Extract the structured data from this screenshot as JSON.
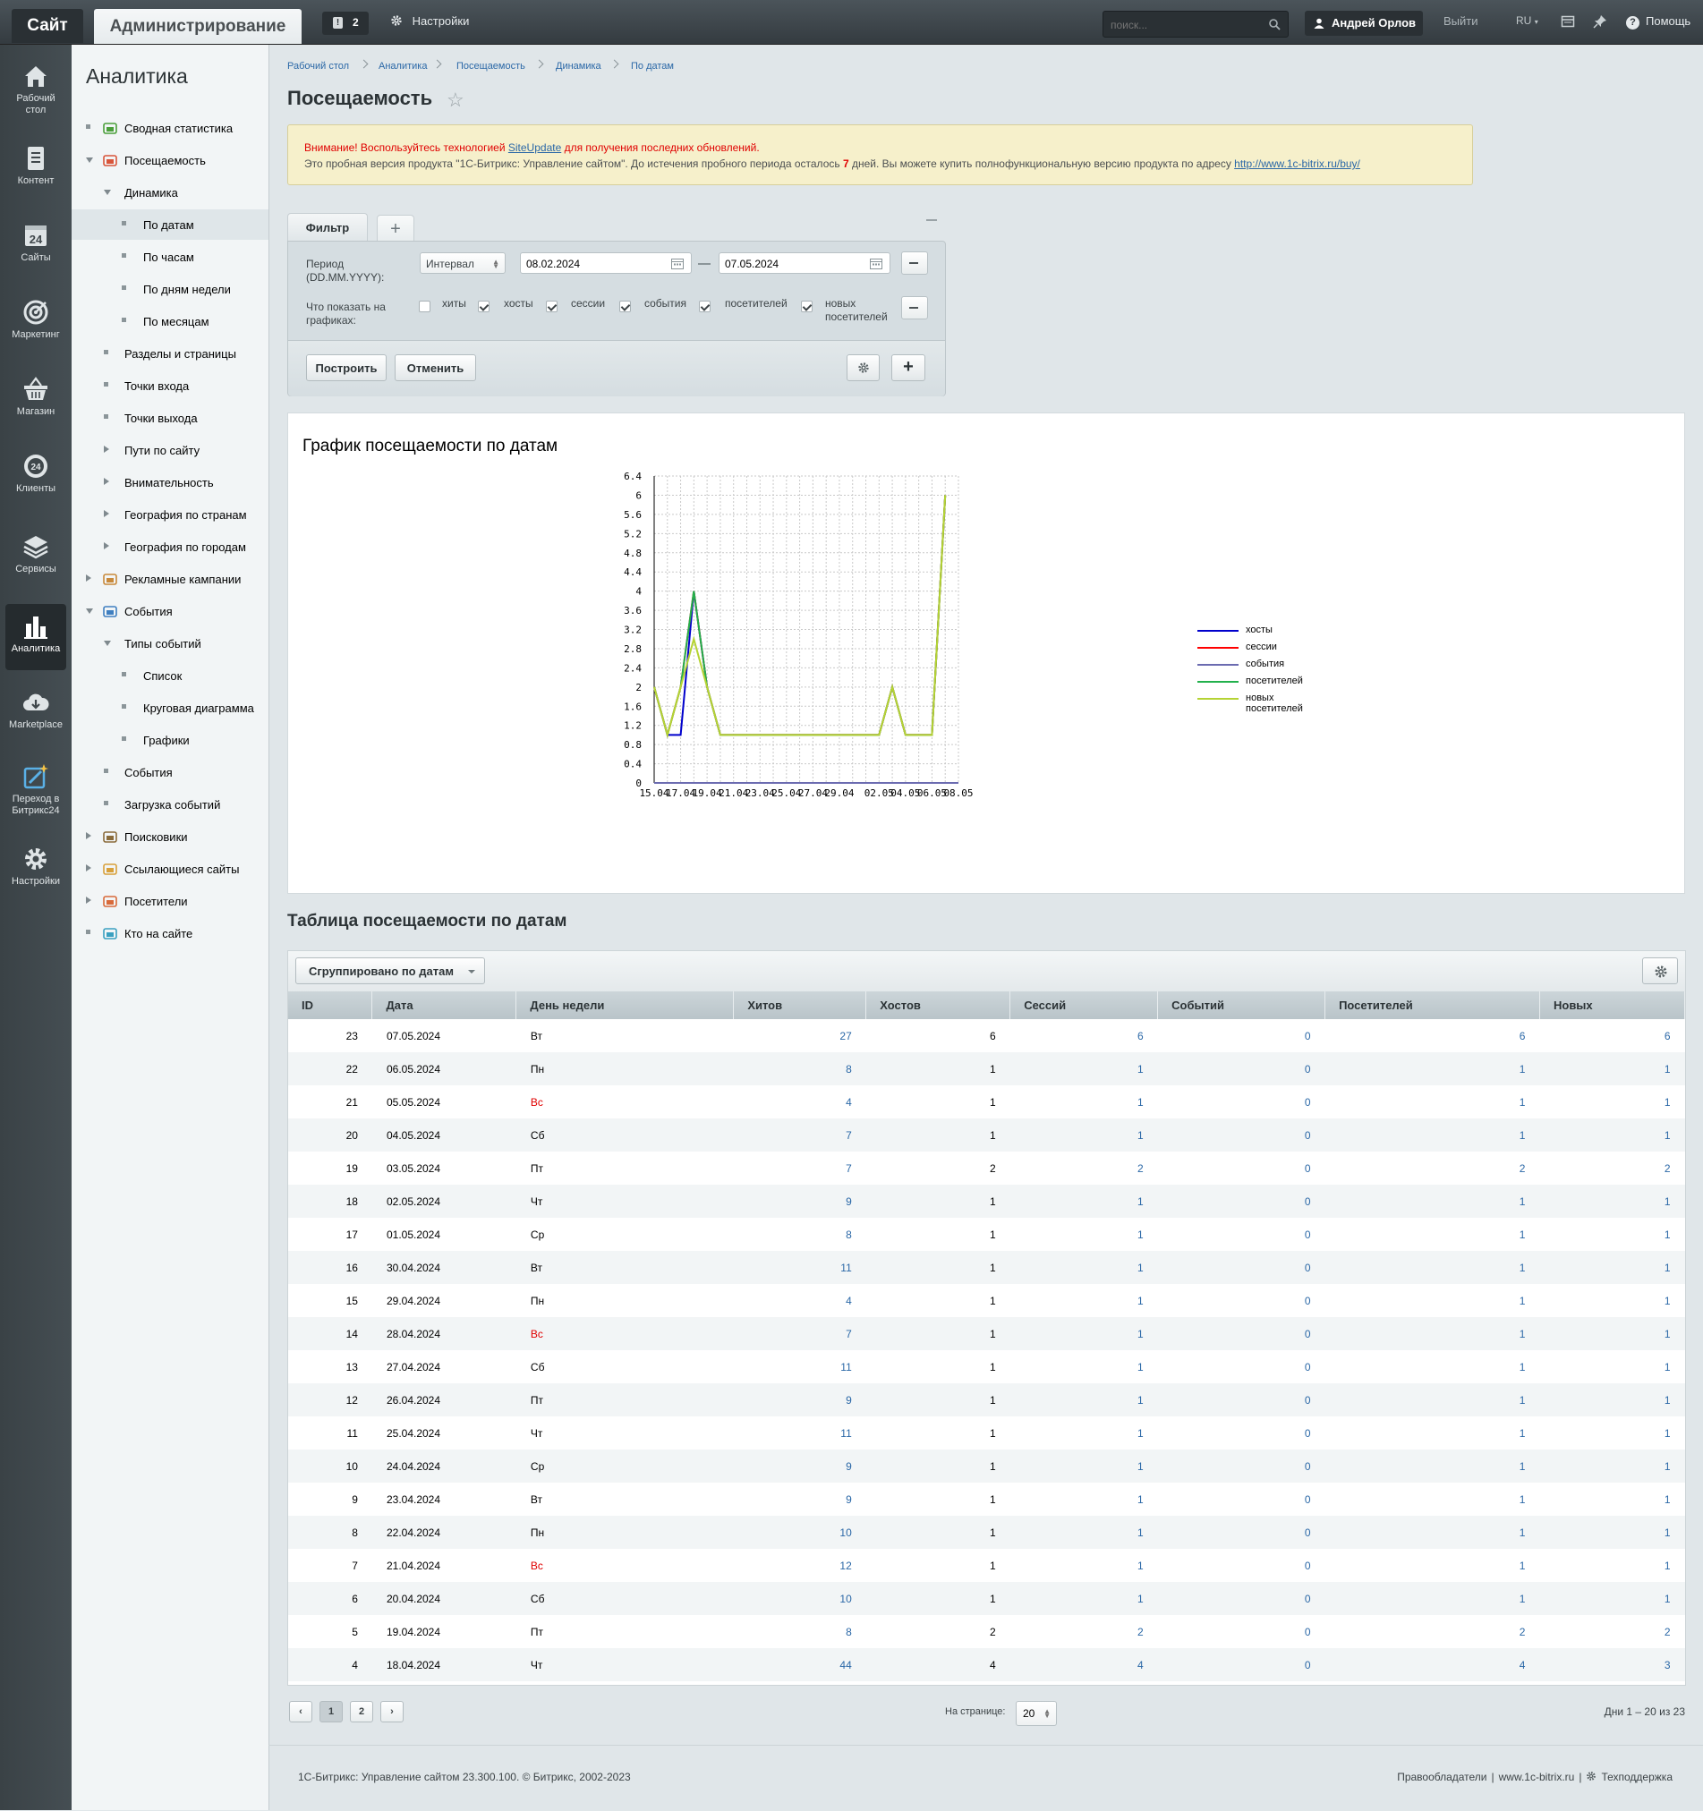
{
  "topbar": {
    "site_tab": "Сайт",
    "admin_tab": "Администрирование",
    "notifications_count": "2",
    "settings_label": "Настройки",
    "search_placeholder": "поиск...",
    "user_name": "Андрей Орлов",
    "logout_label": "Выйти",
    "language": "RU",
    "help_label": "Помощь"
  },
  "leftbar": [
    {
      "label": "Рабочий стол",
      "icon": "home-icon"
    },
    {
      "label": "Контент",
      "icon": "document-icon"
    },
    {
      "label": "Сайты",
      "icon": "calendar-24-icon"
    },
    {
      "label": "Маркетинг",
      "icon": "target-icon"
    },
    {
      "label": "Магазин",
      "icon": "basket-icon"
    },
    {
      "label": "Клиенты",
      "icon": "clients-24-icon"
    },
    {
      "label": "Сервисы",
      "icon": "layers-icon"
    },
    {
      "label": "Аналитика",
      "icon": "bar-chart-icon"
    },
    {
      "label": "Marketplace",
      "icon": "cloud-download-icon"
    },
    {
      "label": "Переход в Битрикс24",
      "icon": "magic-wand-icon"
    },
    {
      "label": "Настройки",
      "icon": "gear-icon"
    }
  ],
  "sidebar": {
    "title": "Аналитика",
    "items": [
      {
        "label": "Сводная статистика"
      },
      {
        "label": "Посещаемость"
      },
      {
        "label": "Динамика"
      },
      {
        "label": "По датам"
      },
      {
        "label": "По часам"
      },
      {
        "label": "По дням недели"
      },
      {
        "label": "По месяцам"
      },
      {
        "label": "Разделы и страницы"
      },
      {
        "label": "Точки входа"
      },
      {
        "label": "Точки выхода"
      },
      {
        "label": "Пути по сайту"
      },
      {
        "label": "Внимательность"
      },
      {
        "label": "География по странам"
      },
      {
        "label": "География по городам"
      },
      {
        "label": "Рекламные кампании"
      },
      {
        "label": "События"
      },
      {
        "label": "Типы событий"
      },
      {
        "label": "Список"
      },
      {
        "label": "Круговая диаграмма"
      },
      {
        "label": "Графики"
      },
      {
        "label": "События"
      },
      {
        "label": "Загрузка событий"
      },
      {
        "label": "Поисковики"
      },
      {
        "label": "Ссылающиеся сайты"
      },
      {
        "label": "Посетители"
      },
      {
        "label": "Кто на сайте"
      }
    ]
  },
  "breadcrumb": [
    "Рабочий стол",
    "Аналитика",
    "Посещаемость",
    "Динамика",
    "По датам"
  ],
  "page_title": "Посещаемость",
  "warning": {
    "line1_before": "Внимание! Воспользуйтесь технологией ",
    "line1_link": "SiteUpdate",
    "line1_after": " для получения последних обновлений.",
    "line2_before": "Это пробная версия продукта \"1С-Битрикс: Управление сайтом\". До истечения пробного периода осталось ",
    "line2_days": "7",
    "line2_after": " дней. Вы можете купить полнофункциональную версию продукта по адресу ",
    "line2_link": "http://www.1c-bitrix.ru/buy/"
  },
  "filter": {
    "tab_label": "Фильтр",
    "period_label": "Период (DD.MM.YYYY):",
    "period_mode": "Интервал",
    "date_from": "08.02.2024",
    "date_to": "07.05.2024",
    "show_label": "Что показать на графиках:",
    "checks": [
      {
        "label": "хиты",
        "checked": false
      },
      {
        "label": "хосты",
        "checked": true
      },
      {
        "label": "сессии",
        "checked": true
      },
      {
        "label": "события",
        "checked": true
      },
      {
        "label": "посетителей",
        "checked": true
      },
      {
        "label": "новых посетителей",
        "checked": true
      }
    ],
    "build_label": "Построить",
    "cancel_label": "Отменить"
  },
  "chart_title": "График посещаемости по датам",
  "chart_data": {
    "type": "line",
    "title": "График посещаемости по датам",
    "x_ticks": [
      "15.04",
      "17.04",
      "19.04",
      "21.04",
      "23.04",
      "25.04",
      "27.04",
      "29.04",
      "02.05",
      "04.05",
      "06.05",
      "08.05"
    ],
    "y_ticks": [
      "0",
      "0.4",
      "0.8",
      "1.2",
      "1.6",
      "2",
      "2.4",
      "2.8",
      "3.2",
      "3.6",
      "4",
      "4.4",
      "4.8",
      "5.2",
      "5.6",
      "6",
      "6.4"
    ],
    "ylim": [
      0,
      6.4
    ],
    "grid": true,
    "legend_position": "right",
    "x_dates": [
      "15.04",
      "16.04",
      "17.04",
      "18.04",
      "19.04",
      "20.04",
      "21.04",
      "22.04",
      "23.04",
      "24.04",
      "25.04",
      "26.04",
      "27.04",
      "28.04",
      "29.04",
      "30.04",
      "01.05",
      "02.05",
      "03.05",
      "04.05",
      "05.05",
      "06.05",
      "07.05",
      "08.05"
    ],
    "series": [
      {
        "name": "хосты",
        "color": "#0000cc",
        "values": [
          2,
          1,
          1,
          4,
          2,
          1,
          1,
          1,
          1,
          1,
          1,
          1,
          1,
          1,
          1,
          1,
          1,
          1,
          2,
          1,
          1,
          1,
          6,
          null
        ]
      },
      {
        "name": "сессии",
        "color": "#ff0000",
        "values": [
          2,
          1,
          2,
          4,
          2,
          1,
          1,
          1,
          1,
          1,
          1,
          1,
          1,
          1,
          1,
          1,
          1,
          1,
          2,
          1,
          1,
          1,
          6,
          null
        ]
      },
      {
        "name": "события",
        "color": "#6b6bb0",
        "values": [
          0,
          0,
          0,
          0,
          0,
          0,
          0,
          0,
          0,
          0,
          0,
          0,
          0,
          0,
          0,
          0,
          0,
          0,
          0,
          0,
          0,
          0,
          0,
          0
        ]
      },
      {
        "name": "посетителей",
        "color": "#22b14c",
        "values": [
          2,
          1,
          2,
          4,
          2,
          1,
          1,
          1,
          1,
          1,
          1,
          1,
          1,
          1,
          1,
          1,
          1,
          1,
          2,
          1,
          1,
          1,
          6,
          null
        ]
      },
      {
        "name": "новых посетителей",
        "color": "#b5d334",
        "values": [
          2,
          1,
          2,
          3,
          2,
          1,
          1,
          1,
          1,
          1,
          1,
          1,
          1,
          1,
          1,
          1,
          1,
          1,
          2,
          1,
          1,
          1,
          6,
          null
        ]
      }
    ]
  },
  "table": {
    "title": "Таблица посещаемости по датам",
    "group_label": "Сгруппировано по датам",
    "columns": [
      "ID",
      "Дата",
      "День недели",
      "Хитов",
      "Хостов",
      "Сессий",
      "Событий",
      "Посетителей",
      "Новых"
    ],
    "rows": [
      {
        "id": "23",
        "date": "07.05.2024",
        "dow": "Вт",
        "weekend": false,
        "hits": "27",
        "hosts": "6",
        "sessions": "6",
        "events": "0",
        "visitors": "6",
        "new": "6"
      },
      {
        "id": "22",
        "date": "06.05.2024",
        "dow": "Пн",
        "weekend": false,
        "hits": "8",
        "hosts": "1",
        "sessions": "1",
        "events": "0",
        "visitors": "1",
        "new": "1"
      },
      {
        "id": "21",
        "date": "05.05.2024",
        "dow": "Вс",
        "weekend": true,
        "hits": "4",
        "hosts": "1",
        "sessions": "1",
        "events": "0",
        "visitors": "1",
        "new": "1"
      },
      {
        "id": "20",
        "date": "04.05.2024",
        "dow": "Сб",
        "weekend": false,
        "hits": "7",
        "hosts": "1",
        "sessions": "1",
        "events": "0",
        "visitors": "1",
        "new": "1"
      },
      {
        "id": "19",
        "date": "03.05.2024",
        "dow": "Пт",
        "weekend": false,
        "hits": "7",
        "hosts": "2",
        "sessions": "2",
        "events": "0",
        "visitors": "2",
        "new": "2"
      },
      {
        "id": "18",
        "date": "02.05.2024",
        "dow": "Чт",
        "weekend": false,
        "hits": "9",
        "hosts": "1",
        "sessions": "1",
        "events": "0",
        "visitors": "1",
        "new": "1"
      },
      {
        "id": "17",
        "date": "01.05.2024",
        "dow": "Ср",
        "weekend": false,
        "hits": "8",
        "hosts": "1",
        "sessions": "1",
        "events": "0",
        "visitors": "1",
        "new": "1"
      },
      {
        "id": "16",
        "date": "30.04.2024",
        "dow": "Вт",
        "weekend": false,
        "hits": "11",
        "hosts": "1",
        "sessions": "1",
        "events": "0",
        "visitors": "1",
        "new": "1"
      },
      {
        "id": "15",
        "date": "29.04.2024",
        "dow": "Пн",
        "weekend": false,
        "hits": "4",
        "hosts": "1",
        "sessions": "1",
        "events": "0",
        "visitors": "1",
        "new": "1"
      },
      {
        "id": "14",
        "date": "28.04.2024",
        "dow": "Вс",
        "weekend": true,
        "hits": "7",
        "hosts": "1",
        "sessions": "1",
        "events": "0",
        "visitors": "1",
        "new": "1"
      },
      {
        "id": "13",
        "date": "27.04.2024",
        "dow": "Сб",
        "weekend": false,
        "hits": "11",
        "hosts": "1",
        "sessions": "1",
        "events": "0",
        "visitors": "1",
        "new": "1"
      },
      {
        "id": "12",
        "date": "26.04.2024",
        "dow": "Пт",
        "weekend": false,
        "hits": "9",
        "hosts": "1",
        "sessions": "1",
        "events": "0",
        "visitors": "1",
        "new": "1"
      },
      {
        "id": "11",
        "date": "25.04.2024",
        "dow": "Чт",
        "weekend": false,
        "hits": "11",
        "hosts": "1",
        "sessions": "1",
        "events": "0",
        "visitors": "1",
        "new": "1"
      },
      {
        "id": "10",
        "date": "24.04.2024",
        "dow": "Ср",
        "weekend": false,
        "hits": "9",
        "hosts": "1",
        "sessions": "1",
        "events": "0",
        "visitors": "1",
        "new": "1"
      },
      {
        "id": "9",
        "date": "23.04.2024",
        "dow": "Вт",
        "weekend": false,
        "hits": "9",
        "hosts": "1",
        "sessions": "1",
        "events": "0",
        "visitors": "1",
        "new": "1"
      },
      {
        "id": "8",
        "date": "22.04.2024",
        "dow": "Пн",
        "weekend": false,
        "hits": "10",
        "hosts": "1",
        "sessions": "1",
        "events": "0",
        "visitors": "1",
        "new": "1"
      },
      {
        "id": "7",
        "date": "21.04.2024",
        "dow": "Вс",
        "weekend": true,
        "hits": "12",
        "hosts": "1",
        "sessions": "1",
        "events": "0",
        "visitors": "1",
        "new": "1"
      },
      {
        "id": "6",
        "date": "20.04.2024",
        "dow": "Сб",
        "weekend": false,
        "hits": "10",
        "hosts": "1",
        "sessions": "1",
        "events": "0",
        "visitors": "1",
        "new": "1"
      },
      {
        "id": "5",
        "date": "19.04.2024",
        "dow": "Пт",
        "weekend": false,
        "hits": "8",
        "hosts": "2",
        "sessions": "2",
        "events": "0",
        "visitors": "2",
        "new": "2"
      },
      {
        "id": "4",
        "date": "18.04.2024",
        "dow": "Чт",
        "weekend": false,
        "hits": "44",
        "hosts": "4",
        "sessions": "4",
        "events": "0",
        "visitors": "4",
        "new": "3"
      }
    ]
  },
  "pagination": {
    "prev": "‹",
    "pages": [
      "1",
      "2"
    ],
    "current": "1",
    "next": "›",
    "per_page_label": "На странице:",
    "per_page": "20",
    "range": "Дни 1 – 20 из 23"
  },
  "footer": {
    "copyright": "1С-Битрикс: Управление сайтом 23.300.100. © Битрикс, 2002-2023",
    "link1": "Правообладатели",
    "link2": "www.1c-bitrix.ru",
    "link3": "Техподдержка",
    "separator": "|"
  }
}
